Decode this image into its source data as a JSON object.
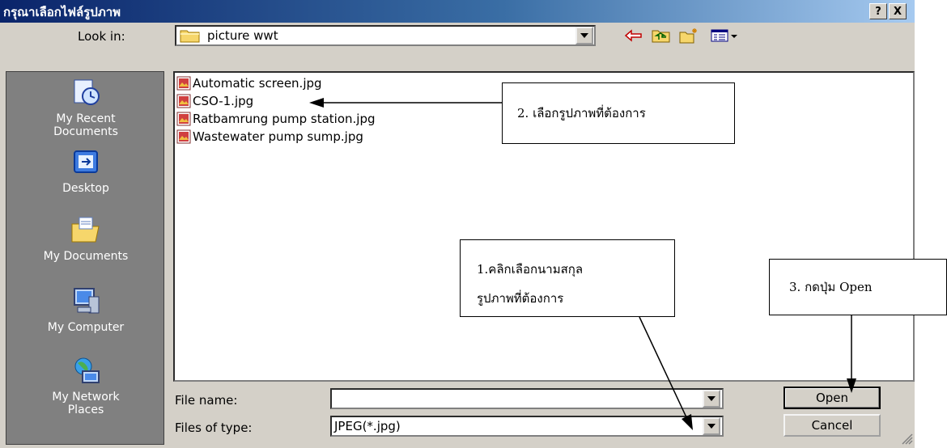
{
  "window": {
    "title": "กรุณาเลือกไฟล์รูปภาพ",
    "help_label": "?",
    "close_label": "X"
  },
  "lookin": {
    "label": "Look in:",
    "value": "picture wwt"
  },
  "toolbar": {
    "icons": [
      "back-arrow-icon",
      "up-folder-icon",
      "new-folder-icon",
      "view-menu-icon"
    ]
  },
  "places": [
    {
      "label_line1": "My Recent",
      "label_line2": "Documents",
      "icon": "recent-documents-icon"
    },
    {
      "label_line1": "Desktop",
      "label_line2": "",
      "icon": "desktop-icon"
    },
    {
      "label_line1": "My Documents",
      "label_line2": "",
      "icon": "my-documents-icon"
    },
    {
      "label_line1": "My Computer",
      "label_line2": "",
      "icon": "my-computer-icon"
    },
    {
      "label_line1": "My Network",
      "label_line2": "Places",
      "icon": "network-places-icon"
    }
  ],
  "files": [
    {
      "name": "Automatic screen.jpg"
    },
    {
      "name": "CSO-1.jpg"
    },
    {
      "name": "Ratbamrung pump station.jpg"
    },
    {
      "name": "Wastewater pump sump.jpg"
    }
  ],
  "bottom": {
    "filename_label": "File name:",
    "filename_value": "",
    "filetype_label": "Files of type:",
    "filetype_value": "JPEG(*.jpg)",
    "open_label": "Open",
    "cancel_label": "Cancel"
  },
  "callouts": {
    "c1_line1": "1.คลิกเลือกนามสกุล",
    "c1_line2": "รูปภาพที่ต้องการ",
    "c2": "2. เลือกรูปภาพที่ต้องการ",
    "c3": "3. กดปุ่ม Open"
  },
  "colors": {
    "dialog_bg": "#d4d0c8",
    "title_start": "#0a246a",
    "title_end": "#a6caf0",
    "places_bg": "#808080"
  }
}
